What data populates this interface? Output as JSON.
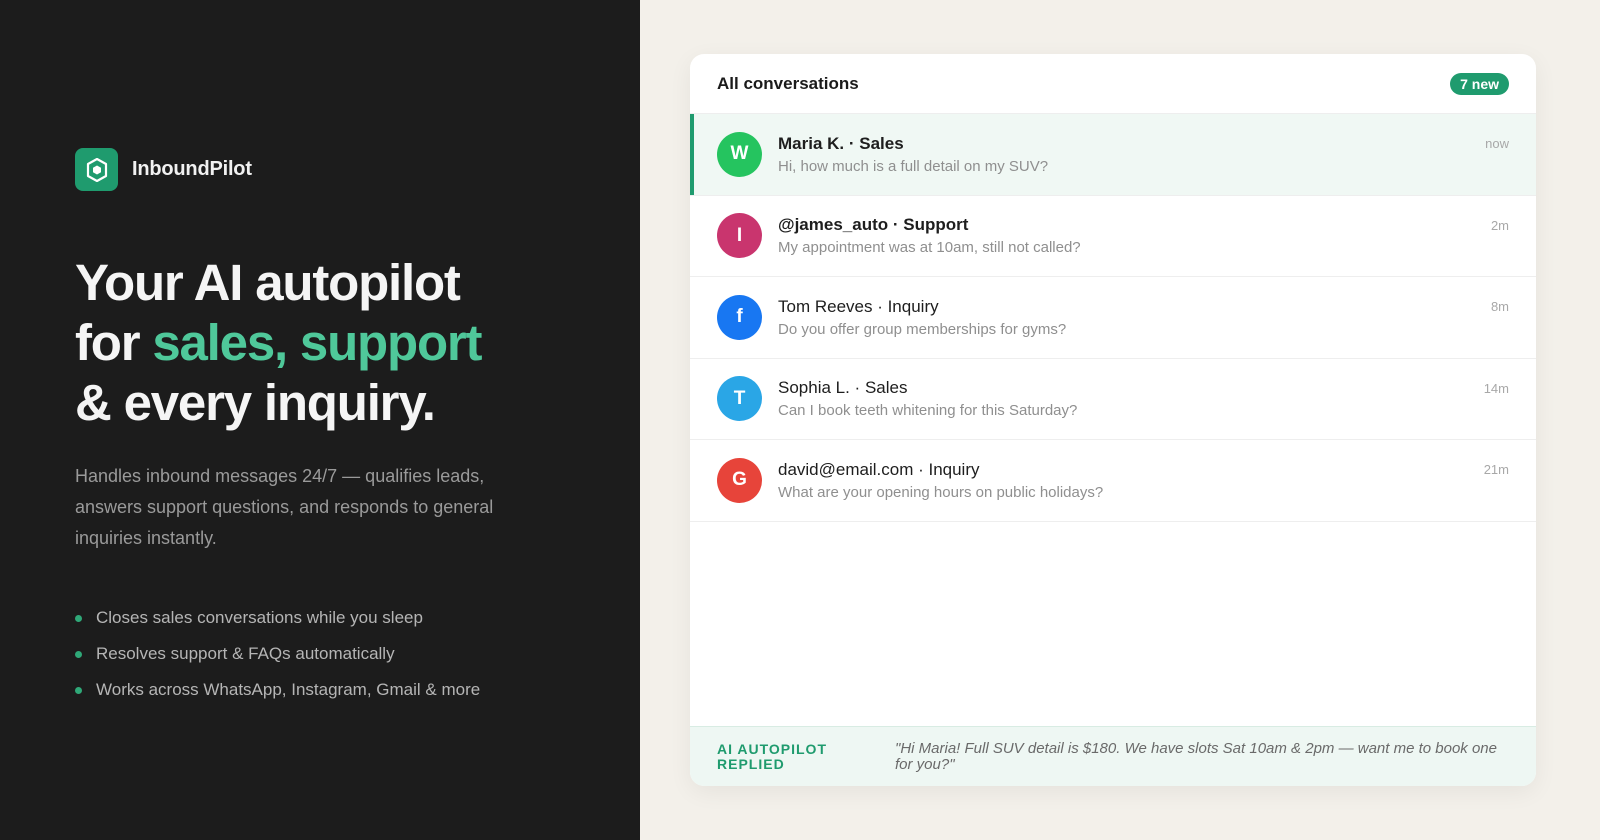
{
  "brand": {
    "name": "InboundPilot",
    "logo_icon": "hexagon-shield-icon",
    "accent": "#1f9b6e"
  },
  "hero": {
    "line1": "Your AI autopilot",
    "line2_prefix": "for ",
    "line2_accent": "sales, support",
    "line3": "& every inquiry.",
    "subtitle": "Handles inbound messages 24/7 — qualifies leads, answers support questions, and responds to general inquiries instantly.",
    "bullets": [
      "Closes sales conversations while you sleep",
      "Resolves support & FAQs automatically",
      "Works across WhatsApp, Instagram, Gmail & more"
    ]
  },
  "inbox": {
    "title": "All conversations",
    "badge": "7 new",
    "rows": [
      {
        "initial": "W",
        "color": "#25c45f",
        "title": "Maria K. · Sales",
        "message": "Hi, how much is a full detail on my SUV?",
        "time": "now",
        "active": true,
        "bold": true
      },
      {
        "initial": "I",
        "color": "#c9356e",
        "title": "@james_auto · Support",
        "message": "My appointment was at 10am, still not called?",
        "time": "2m",
        "active": false,
        "bold": true
      },
      {
        "initial": "f",
        "color": "#1877f2",
        "title": "Tom Reeves · Inquiry",
        "message": "Do you offer group memberships for gyms?",
        "time": "8m",
        "active": false,
        "bold": false
      },
      {
        "initial": "T",
        "color": "#2aa6e6",
        "title": "Sophia L. · Sales",
        "message": "Can I book teeth whitening for this Saturday?",
        "time": "14m",
        "active": false,
        "bold": false
      },
      {
        "initial": "G",
        "color": "#e7443a",
        "title": "david@email.com · Inquiry",
        "message": "What are your opening hours on public holidays?",
        "time": "21m",
        "active": false,
        "bold": false
      }
    ]
  },
  "footer": {
    "label": "AI AUTOPILOT REPLIED",
    "quote": "\"Hi Maria! Full SUV detail is $180. We have slots Sat 10am & 2pm — want me to book one for you?\""
  }
}
